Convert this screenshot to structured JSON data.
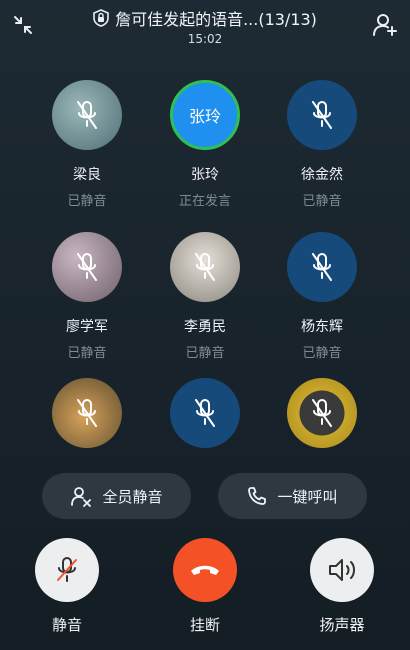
{
  "header": {
    "title": "詹可佳发起的语音...(13/13)",
    "time": "15:02"
  },
  "participants": [
    {
      "name": "梁良",
      "status": "已静音",
      "bg": "#6f8f95"
    },
    {
      "name": "张玲",
      "status": "正在发言",
      "avatar_text": "张玲",
      "bg": "#1f8ff0"
    },
    {
      "name": "徐金然",
      "status": "已静音",
      "bg": "#164a7a"
    },
    {
      "name": "廖学军",
      "status": "已静音",
      "bg": "#8a7b86"
    },
    {
      "name": "李勇民",
      "status": "已静音",
      "bg": "#a09a92"
    },
    {
      "name": "杨东辉",
      "status": "已静音",
      "bg": "#164a7a"
    },
    {
      "name": "",
      "status": "",
      "bg": "#7a6a3e"
    },
    {
      "name": "",
      "status": "",
      "bg": "#164a7a"
    },
    {
      "name": "",
      "status": "",
      "bg": "#b89a2a"
    }
  ],
  "actions": {
    "mute_all": "全员静音",
    "call_all": "一键呼叫"
  },
  "controls": {
    "mute": "静音",
    "hangup": "挂断",
    "speaker": "扬声器"
  },
  "colors": {
    "speaking_border": "#2fbf52",
    "hangup": "#f45226",
    "accent": "#1f8ff0"
  }
}
